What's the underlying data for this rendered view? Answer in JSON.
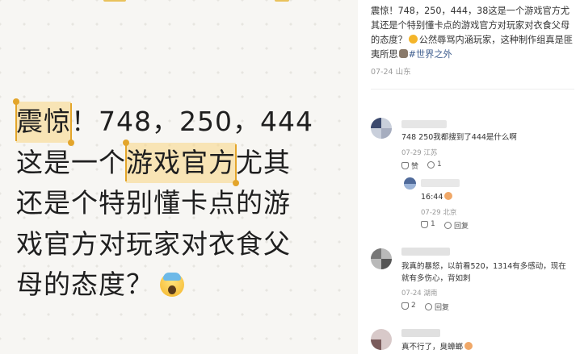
{
  "post_image": {
    "line1_hl": "震惊",
    "line1_rest": "！748，250，444",
    "line2_pre": "这是一个",
    "line2_hl": "游戏官方",
    "line2_post": "尤其",
    "line3": "还是个特别懂卡点的游",
    "line4": "戏官方对玩家对衣食父",
    "line5": "母的态度？"
  },
  "post": {
    "desc_line1": "震惊！748，250，444，38这是一个游戏官方尤",
    "desc_line2": "其还是个特别懂卡点的游戏官方对玩家对衣食父母",
    "desc_line3a": "的态度？",
    "desc_line3b": "公然辱骂内涵玩家，这种制作组真是匪",
    "desc_line4a": "夷所思",
    "desc_tag": "#世界之外",
    "date": "07-24",
    "location": "山东"
  },
  "comments": [
    {
      "text": "748 250我都搜到了444是什么啊",
      "date": "07-29",
      "location": "江苏",
      "like_label": "赞",
      "reply_count": "1"
    },
    {
      "text": "16:44",
      "date": "07-29",
      "location": "北京",
      "like_count": "1",
      "reply_label": "回复"
    },
    {
      "text_line1": "我真的暴怒，以前看520，1314有多感动，现在",
      "text_line2": "就有多伤心，背如刺",
      "date": "07-24",
      "location": "湖南",
      "like_count": "2",
      "reply_label": "回复"
    },
    {
      "text": "真不行了，臭蟑螂"
    }
  ]
}
